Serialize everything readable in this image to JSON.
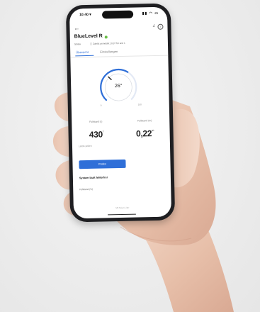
{
  "status_bar": {
    "time": "10:40 ▾",
    "icons": "▮▮ ◠ ▭"
  },
  "app": {
    "device_title": "BlueLevel R",
    "meta_key": "Status",
    "meta_value": "▢ Zuletzt gemeldet 10:37 für und 1",
    "tabs": [
      {
        "label": "Übersicht",
        "active": true
      },
      {
        "label": "Einstellungen",
        "active": false
      }
    ]
  },
  "gauge": {
    "value_text": "26°",
    "min_label": "0",
    "max_label": "100",
    "fill_fraction": 0.62,
    "accent": "#2f6fd8"
  },
  "stats": [
    {
      "label": "Füllstand (l)",
      "value": "430",
      "unit": "l"
    },
    {
      "label": "Füllstand (m)",
      "value": "0,22",
      "unit": "m"
    }
  ],
  "note": "Letzte prüfen",
  "primary_button": "Prüfen",
  "section_title": "System läuft fehlerfrei",
  "field_label": "Füllstand (%)",
  "footer": "Mit freien Liter"
}
